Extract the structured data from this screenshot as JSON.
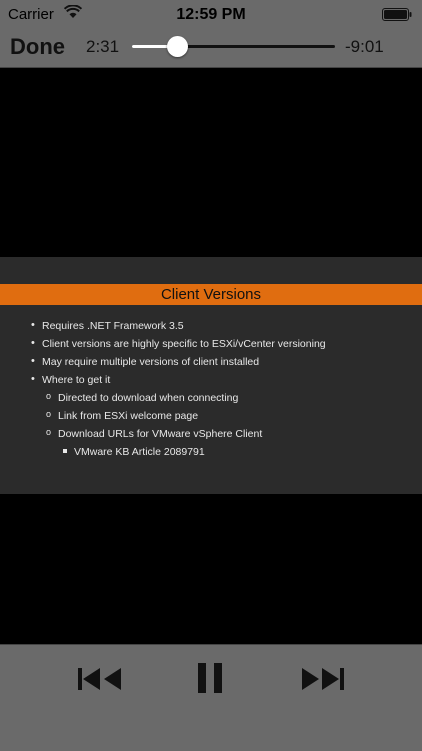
{
  "status_bar": {
    "carrier": "Carrier",
    "time": "12:59 PM"
  },
  "player": {
    "done_label": "Done",
    "elapsed": "2:31",
    "remaining": "-9:01",
    "progress": 0.22
  },
  "slide": {
    "title": "Client Versions",
    "bullets": [
      "Requires .NET Framework 3.5",
      "Client versions are highly specific to ESXi/vCenter versioning",
      "May require multiple versions of client installed",
      "Where to get it"
    ],
    "sub_bullets": [
      "Directed to download when connecting",
      "Link from ESXi welcome page",
      "Download URLs for VMware vSphere Client"
    ],
    "sub_sub_bullets": [
      "VMware KB Article 2089791"
    ]
  },
  "icons": {
    "wifi": "wifi-icon",
    "battery": "battery-icon",
    "previous": "skip-back-icon",
    "pause": "pause-icon",
    "next": "skip-forward-icon"
  },
  "colors": {
    "accent": "#e06d10",
    "bar": "#6a6a6a",
    "slide_bg": "#2b2b2b"
  }
}
